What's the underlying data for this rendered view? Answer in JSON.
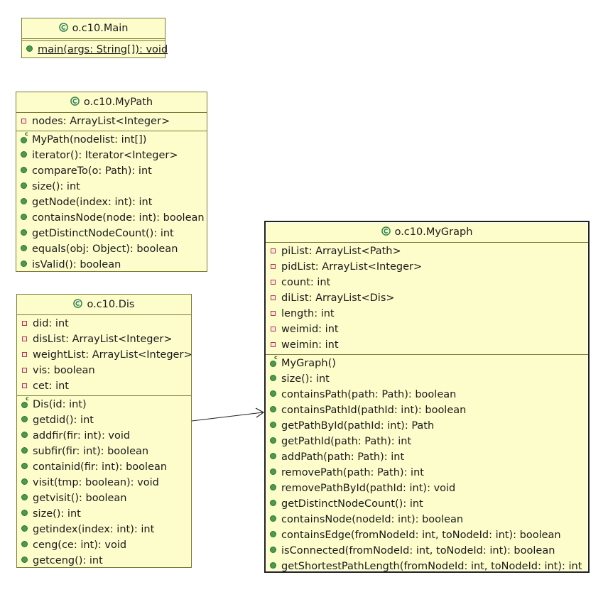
{
  "classes": {
    "main": {
      "name": "o.c10.Main",
      "attributes": [],
      "operations": [
        {
          "text": "main(args: String[]): void",
          "kind": "static"
        }
      ]
    },
    "mypath": {
      "name": "o.c10.MyPath",
      "attributes": [
        {
          "text": "nodes: ArrayList<Integer>"
        }
      ],
      "operations": [
        {
          "text": "MyPath(nodelist: int[])",
          "kind": "ctor"
        },
        {
          "text": "iterator(): Iterator<Integer>",
          "kind": "method"
        },
        {
          "text": "compareTo(o: Path): int",
          "kind": "method"
        },
        {
          "text": "size(): int",
          "kind": "method"
        },
        {
          "text": "getNode(index: int): int",
          "kind": "method"
        },
        {
          "text": "containsNode(node: int): boolean",
          "kind": "method"
        },
        {
          "text": "getDistinctNodeCount(): int",
          "kind": "method"
        },
        {
          "text": "equals(obj: Object): boolean",
          "kind": "method"
        },
        {
          "text": "isValid(): boolean",
          "kind": "method"
        }
      ]
    },
    "dis": {
      "name": "o.c10.Dis",
      "attributes": [
        {
          "text": "did: int"
        },
        {
          "text": "disList: ArrayList<Integer>"
        },
        {
          "text": "weightList: ArrayList<Integer>"
        },
        {
          "text": "vis: boolean"
        },
        {
          "text": "cet: int"
        }
      ],
      "operations": [
        {
          "text": "Dis(id: int)",
          "kind": "ctor"
        },
        {
          "text": "getdid(): int",
          "kind": "method"
        },
        {
          "text": "addfir(fir: int): void",
          "kind": "method"
        },
        {
          "text": "subfir(fir: int): boolean",
          "kind": "method"
        },
        {
          "text": "containid(fir: int): boolean",
          "kind": "method"
        },
        {
          "text": "visit(tmp: boolean): void",
          "kind": "method"
        },
        {
          "text": "getvisit(): boolean",
          "kind": "method"
        },
        {
          "text": "size(): int",
          "kind": "method"
        },
        {
          "text": "getindex(index: int): int",
          "kind": "method"
        },
        {
          "text": "ceng(ce: int): void",
          "kind": "method"
        },
        {
          "text": "getceng(): int",
          "kind": "method"
        }
      ]
    },
    "mygraph": {
      "name": "o.c10.MyGraph",
      "attributes": [
        {
          "text": "piList: ArrayList<Path>"
        },
        {
          "text": "pidList: ArrayList<Integer>"
        },
        {
          "text": "count: int"
        },
        {
          "text": "diList: ArrayList<Dis>"
        },
        {
          "text": "length: int"
        },
        {
          "text": "weimid: int"
        },
        {
          "text": "weimin: int"
        }
      ],
      "operations": [
        {
          "text": "MyGraph()",
          "kind": "ctor"
        },
        {
          "text": "size(): int",
          "kind": "method"
        },
        {
          "text": "containsPath(path: Path): boolean",
          "kind": "method"
        },
        {
          "text": "containsPathId(pathId: int): boolean",
          "kind": "method"
        },
        {
          "text": "getPathById(pathId: int): Path",
          "kind": "method"
        },
        {
          "text": "getPathId(path: Path): int",
          "kind": "method"
        },
        {
          "text": "addPath(path: Path): int",
          "kind": "method"
        },
        {
          "text": "removePath(path: Path): int",
          "kind": "method"
        },
        {
          "text": "removePathById(pathId: int): void",
          "kind": "method"
        },
        {
          "text": "getDistinctNodeCount(): int",
          "kind": "method"
        },
        {
          "text": "containsNode(nodeId: int): boolean",
          "kind": "method"
        },
        {
          "text": "containsEdge(fromNodeId: int, toNodeId: int): boolean",
          "kind": "method"
        },
        {
          "text": "isConnected(fromNodeId: int, toNodeId: int): boolean",
          "kind": "method"
        },
        {
          "text": "getShortestPathLength(fromNodeId: int, toNodeId: int): int",
          "kind": "method"
        }
      ]
    }
  },
  "relations": [
    {
      "from": "o.c10.Dis",
      "to": "o.c10.MyGraph",
      "type": "association",
      "arrow": "open"
    }
  ],
  "colors": {
    "class_fill": "#fdfdcc",
    "class_border": "#7a7a3a",
    "public_icon": "#4c9a4c",
    "private_icon": "#b23a3a",
    "class_icon": "#2f7f2f"
  }
}
